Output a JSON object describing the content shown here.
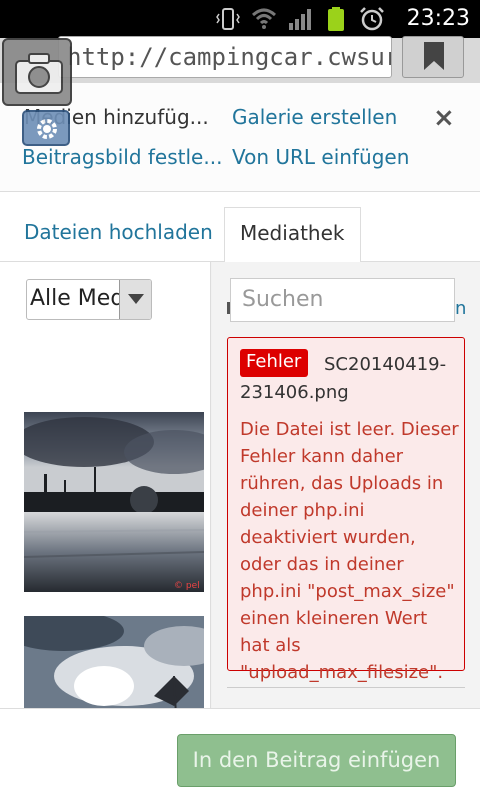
{
  "status_bar": {
    "time": "23:23",
    "icons": [
      "vibrate-icon",
      "wifi-icon",
      "signal-icon",
      "battery-icon",
      "alarm-icon"
    ]
  },
  "browser": {
    "url": "http://campingcar.cwsur..."
  },
  "modal_header": {
    "add_media": "Medien hinzufüg...",
    "create_gallery": "Galerie erstellen",
    "set_featured_image": "Beitragsbild festle...",
    "insert_from_url": "Von URL einfügen",
    "close": "×"
  },
  "tabs": {
    "upload": "Dateien hochladen",
    "library": "Mediathek"
  },
  "library": {
    "filter_value": "Alle Med",
    "search_placeholder": "Suchen",
    "search_label_peek": "n"
  },
  "error": {
    "badge": "Fehler",
    "filename": "SC20140419-231406.png",
    "message": "Die Datei ist leer. Dieser Fehler kann daher rühren, das Uploads in deiner php.ini deaktiviert wurden, oder das in deiner php.ini \"post_max_size\" einen kleineren Wert hat als \"upload_max_filesize\"."
  },
  "footer": {
    "insert_button": "In den Beitrag einfügen"
  },
  "colors": {
    "link": "#21759b",
    "error_red": "#c0392b",
    "error_badge": "#dd0000",
    "button_disabled": "#8fbf8f"
  }
}
